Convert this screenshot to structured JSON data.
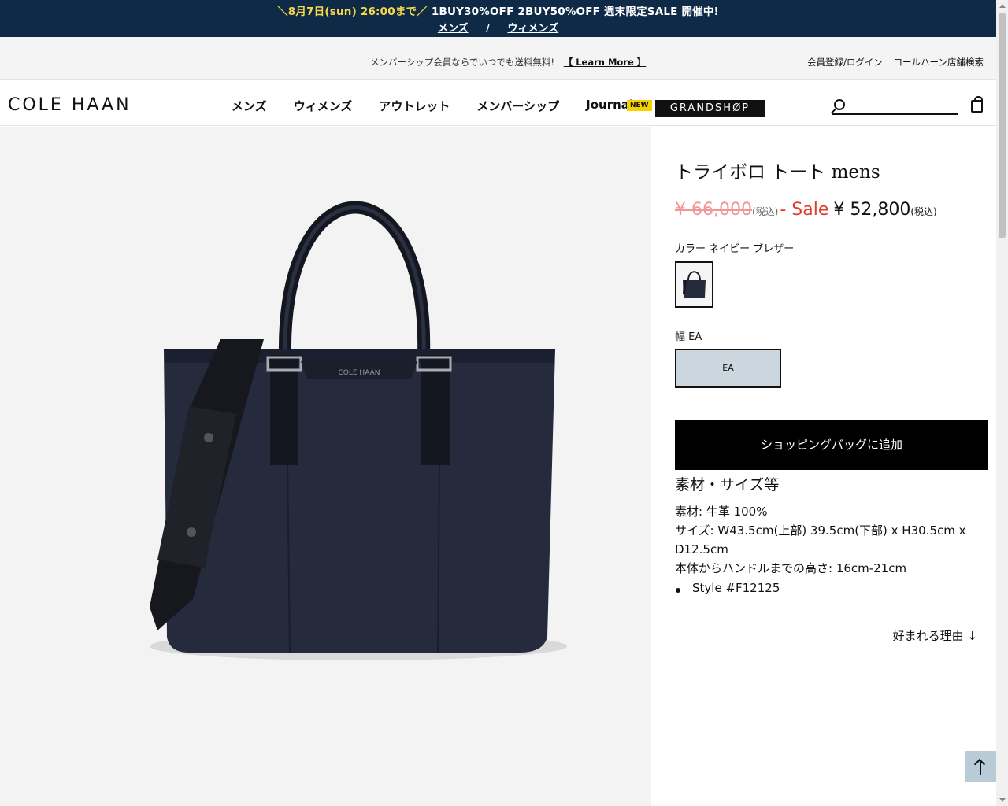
{
  "promo": {
    "prefix": "＼",
    "date": "8月7日(sun) 26:00まで",
    "suffix": "／",
    "text": "1BUY30%OFF 2BUY50%OFF 週末限定SALE 開催中!",
    "link_mens": "メンズ",
    "separator": "/",
    "link_womens": "ウィメンズ"
  },
  "utility": {
    "message": "メンバーシップ会員ならでいつでも送料無料!",
    "learn_more": "【 Learn More 】",
    "login": "会員登録/ログイン",
    "store_search": "コールハーン店舗検索"
  },
  "nav": {
    "logo": "COLE HAAN",
    "items": [
      "メンズ",
      "ウィメンズ",
      "アウトレット",
      "メンバーシップ",
      "Journal"
    ],
    "new_badge": "NEW",
    "grandshop": "GRANDSHØP"
  },
  "search": {
    "placeholder": ""
  },
  "product": {
    "title": "トライボロ トート mens",
    "price_original": "¥ 66,000",
    "tax_label": "(税込)",
    "sale_label": "- Sale",
    "price_sale": "¥ 52,800",
    "tax_label_sale": "(税込)",
    "color_label": "カラー ネイビー ブレザー",
    "width_label": "幅 EA",
    "width_option": "EA",
    "add_to_bag": "ショッピングバッグに追加",
    "spec_title": "素材・サイズ等",
    "spec_lines": [
      "素材: 牛革 100%",
      "サイズ: W43.5cm(上部) 39.5cm(下部) x H30.5cm x D12.5cm",
      "本体からハンドルまでの高さ: 16cm-21cm"
    ],
    "style_number": "Style #F12125",
    "reason_link": "好まれる理由 ↓",
    "bag_logo_text": "COLE HAAN"
  },
  "colors": {
    "promo_bg": "#0e2a47",
    "promo_highlight": "#f7d84a",
    "sale_red": "#e13b2e",
    "width_selected": "#cbd6de",
    "bag_navy": "#252b3d"
  }
}
